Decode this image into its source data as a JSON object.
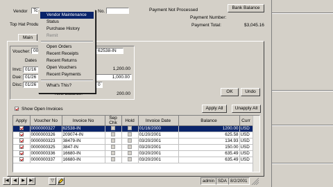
{
  "header": {
    "vendor_label": "Vendor",
    "vendor_value": "Tc",
    "no_label": "No.",
    "payment_status": "Payment Not Processed",
    "bank_balance_button": "Bank Balance",
    "payment_number_label": "Payment Number:",
    "payment_total_label": "Payment Total:",
    "payment_total_value": "$3,045.16",
    "company_text": "Top Hat Produ"
  },
  "context_menu": {
    "items": [
      {
        "label": "Vendor Maintenance",
        "state": "highlighted"
      },
      {
        "label": "Status",
        "state": "normal"
      },
      {
        "label": "Purchase History",
        "state": "normal"
      },
      {
        "label": "Remit",
        "state": "disabled"
      },
      {
        "label": "Open Orders",
        "state": "normal"
      },
      {
        "label": "Recent Receipts",
        "state": "normal"
      },
      {
        "label": "Recent Returns",
        "state": "normal"
      },
      {
        "label": "Open Vouchers",
        "state": "normal"
      },
      {
        "label": "Recent Payments",
        "state": "normal"
      },
      {
        "label": "What's This?",
        "state": "normal"
      }
    ]
  },
  "tabs": {
    "main": "Main"
  },
  "voucher_panel": {
    "voucher_label": "Voucher:",
    "voucher_prefix": "00",
    "voucher_suffix": "62538-IN",
    "dates_label": "Dates",
    "invc_label": "Invc:",
    "invc_date": "01/16",
    "due_label": "Due:",
    "due_date": "01/26",
    "disc_label": "Disc:",
    "disc_date": "01/26",
    "amount_1": "1,200.00",
    "amount_2": "1,000.00",
    "amount_3": "0",
    "new_balance_label": "New Balance:",
    "new_balance_value": "200.00",
    "ok_button": "OK",
    "undo_button": "Undo"
  },
  "invoices": {
    "show_open_label": "Show Open Invoices",
    "show_open_checked": true,
    "apply_all_button": "Apply All",
    "unapply_all_button": "Unapply All",
    "columns": [
      "Apply",
      "Voucher No",
      "Invoice No",
      "Sep Chk",
      "Hold",
      "Invoice Date",
      "Balance",
      "Curr"
    ],
    "rows": [
      {
        "apply": true,
        "voucher": "0000000327",
        "invoice": "62538-IN",
        "date": "01/16/2000",
        "balance": "1200.00",
        "curr": "USD",
        "selected": true
      },
      {
        "apply": true,
        "voucher": "0000000326",
        "invoice": "209074-IN",
        "date": "01/20/2001",
        "balance": "625.58",
        "curr": "USD",
        "selected": false
      },
      {
        "apply": true,
        "voucher": "0000000323",
        "invoice": "38479-IN",
        "date": "03/20/2001",
        "balance": "134.93",
        "curr": "USD",
        "selected": false
      },
      {
        "apply": true,
        "voucher": "0000000325",
        "invoice": "3847-IN",
        "date": "03/20/2001",
        "balance": "150.00",
        "curr": "USD",
        "selected": false
      },
      {
        "apply": true,
        "voucher": "0000000336",
        "invoice": "16680-IN",
        "date": "03/20/2001",
        "balance": "635.49",
        "curr": "USD",
        "selected": false
      },
      {
        "apply": true,
        "voucher": "0000000337",
        "invoice": "16680-IN",
        "date": "03/20/2001",
        "balance": "635.49",
        "curr": "USD",
        "selected": false
      }
    ]
  },
  "statusbar": {
    "user": "admin",
    "company": "SDA",
    "date": "8/2/2001"
  }
}
